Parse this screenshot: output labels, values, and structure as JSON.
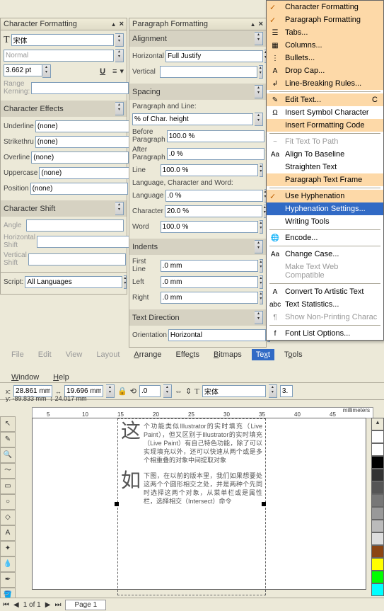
{
  "char_panel": {
    "title": "Character Formatting",
    "font": "宋体",
    "style": "Normal",
    "size": "3.662 pt",
    "kerning": "Range Kerning:",
    "effects_title": "Character Effects",
    "effects": {
      "underline_lbl": "Underline",
      "underline": "(none)",
      "strike_lbl": "Strikethru",
      "strike": "(none)",
      "overline_lbl": "Overline",
      "overline": "(none)",
      "uppercase_lbl": "Uppercase",
      "uppercase": "(none)",
      "position_lbl": "Position",
      "position": "(none)"
    },
    "shift_title": "Character Shift",
    "shift": {
      "angle": "Angle",
      "h": "Horizontal Shift",
      "v": "Vertical Shift"
    },
    "script_lbl": "Script:",
    "script": "All Languages"
  },
  "para_panel": {
    "title": "Paragraph Formatting",
    "alignment_title": "Alignment",
    "horiz_lbl": "Horizontal",
    "horiz": "Full Justify",
    "vert_lbl": "Vertical",
    "spacing_title": "Spacing",
    "pl_lbl": "Paragraph and Line:",
    "pl": "% of Char. height",
    "before_lbl": "Before Paragraph",
    "before": "100.0 %",
    "after_lbl": "After Paragraph",
    "after": ".0 %",
    "line_lbl": "Line",
    "line": "100.0 %",
    "lcw_lbl": "Language, Character and Word:",
    "lang_lbl": "Language",
    "lang": ".0 %",
    "chr_lbl": "Character",
    "chr": "20.0 %",
    "word_lbl": "Word",
    "word": "100.0 %",
    "indents_title": "Indents",
    "first_lbl": "First Line",
    "first": ".0 mm",
    "left_lbl": "Left",
    "left": ".0 mm",
    "right_lbl": "Right",
    "right": ".0 mm",
    "dir_title": "Text Direction",
    "orient_lbl": "Orientation",
    "orient": "Horizontal"
  },
  "menu": [
    {
      "t": "Character Formatting",
      "bg": true,
      "chk": true
    },
    {
      "t": "Paragraph Formatting",
      "bg": true,
      "chk": true
    },
    {
      "t": "Tabs...",
      "bg": true,
      "ico": "☰"
    },
    {
      "t": "Columns...",
      "bg": true,
      "ico": "▦"
    },
    {
      "t": "Bullets...",
      "bg": true,
      "ico": "⋮"
    },
    {
      "t": "Drop Cap...",
      "bg": true,
      "ico": "A"
    },
    {
      "t": "Line-Breaking Rules...",
      "bg": true,
      "ico": "↲"
    },
    {
      "sep": true
    },
    {
      "t": "Edit Text...",
      "bg": true,
      "ico": "✎",
      "sc": "C"
    },
    {
      "t": "Insert Symbol Character",
      "ico": "Ω"
    },
    {
      "t": "Insert Formatting Code",
      "bg": true
    },
    {
      "sep": true
    },
    {
      "t": "Fit Text To Path",
      "dis": true,
      "ico": "~"
    },
    {
      "t": "Align To Baseline",
      "ico": "Aa"
    },
    {
      "t": "Straighten Text"
    },
    {
      "t": "Paragraph Text Frame",
      "bg": true
    },
    {
      "sep": true
    },
    {
      "t": "Use Hyphenation",
      "bg": true,
      "chk": true
    },
    {
      "t": "Hyphenation Settings...",
      "hl": true
    },
    {
      "t": "Writing Tools"
    },
    {
      "sep": true
    },
    {
      "t": "Encode...",
      "ico": "🌐"
    },
    {
      "sep": true
    },
    {
      "t": "Change Case...",
      "ico": "Aa"
    },
    {
      "t": "Make Text Web Compatible",
      "dis": true
    },
    {
      "sep": true
    },
    {
      "t": "Convert To Artistic Text",
      "ico": "A"
    },
    {
      "t": "Text Statistics...",
      "ico": "abc"
    },
    {
      "t": "Show Non-Printing Charac",
      "dis": true,
      "ico": "¶"
    },
    {
      "sep": true
    },
    {
      "t": "Font List Options...",
      "ico": "f"
    }
  ],
  "menubar": {
    "file": "File",
    "edit": "Edit",
    "view": "View",
    "layout": "Layout",
    "arrange": "Arrange",
    "effects": "Effects",
    "bitmaps": "Bitmaps",
    "text": "Text",
    "tools": "Tools",
    "window": "Window",
    "help": "Help"
  },
  "toolbar": {
    "x": "28.861 mm",
    "y": "-89.833 mm",
    "w": "19.696 mm",
    "h": "24.017 mm",
    "rot": ".0",
    "font": "宋体",
    "size": "3."
  },
  "ruler": {
    "unit": "millimeters",
    "ticks": [
      "5",
      "10",
      "15",
      "20",
      "25",
      "30",
      "35",
      "40",
      "45"
    ]
  },
  "doc": {
    "p1": "这",
    "p1b": "个功能类似Illustrator的实时填充（Live Paint），但又区别于Illustrator的实时填充（Live Paint）有自己特色功能，除了可以实现填充以外，还可以快速从两个或是多个相重叠的对象中间提取对象",
    "p2": "如",
    "p2b": "下图，在以前的版本里，我们如果想要处这两个个圆形相交之处，并是两种个先同时选择这两个对象，从菜单栏或是属性栏，选择相交（Intersect）命令"
  },
  "status": {
    "page": "1 of 1",
    "tab": "Page 1"
  },
  "palette": [
    "#fff",
    "#000",
    "#333",
    "#555",
    "#777",
    "#999",
    "#bbb",
    "#ddd",
    "#8b4513",
    "#ff0",
    "#0f0",
    "#0ff"
  ]
}
